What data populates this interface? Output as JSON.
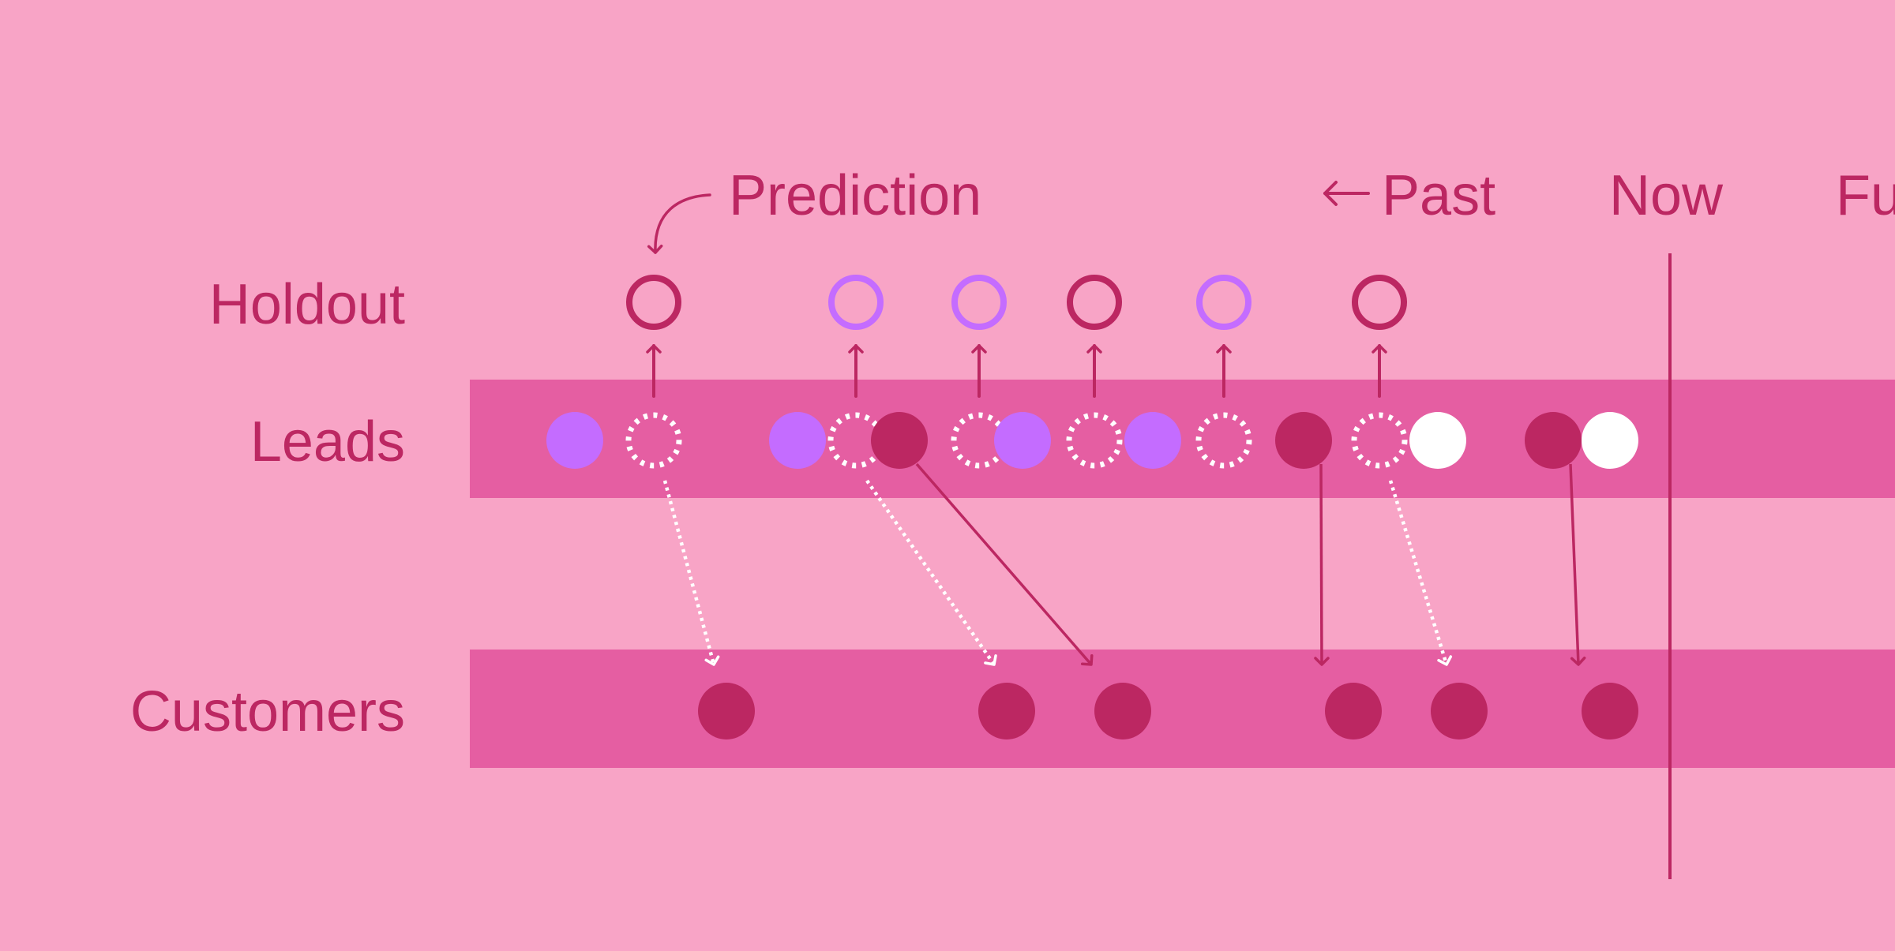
{
  "colors": {
    "background": "#F8A4C6",
    "band": "#E55EA2",
    "accent": "#BC2762",
    "purple": "#C46CFF",
    "white": "#FFFFFF"
  },
  "labels": {
    "prediction": "Prediction",
    "past": "Past",
    "past_arrow": "←",
    "now": "Now",
    "future": "Future"
  },
  "rows": {
    "holdout": "Holdout",
    "leads": "Leads",
    "customers": "Customers"
  },
  "legend_semantics": {
    "purple": "lead that did not convert",
    "dark": "lead that converted",
    "white": "lead not yet resolved",
    "dashed": "lead moved to holdout"
  },
  "holdout": [
    {
      "slot": 1,
      "color": "dark"
    },
    {
      "slot": 4,
      "color": "purple"
    },
    {
      "slot": 6,
      "color": "purple"
    },
    {
      "slot": 8,
      "color": "dark"
    },
    {
      "slot": 10,
      "color": "purple"
    },
    {
      "slot": 12,
      "color": "dark"
    }
  ],
  "leads": [
    {
      "id": "L1",
      "type": "purple"
    },
    {
      "id": "L2",
      "type": "dashed",
      "holdout": 0
    },
    {
      "id": "L3",
      "type": "purple"
    },
    {
      "id": "L4",
      "type": "dashed",
      "holdout": 1
    },
    {
      "id": "L5",
      "type": "dark"
    },
    {
      "id": "L6",
      "type": "dashed",
      "holdout": 2
    },
    {
      "id": "L7",
      "type": "purple"
    },
    {
      "id": "L8",
      "type": "dashed",
      "holdout": 3
    },
    {
      "id": "L9",
      "type": "purple"
    },
    {
      "id": "L10",
      "type": "dashed",
      "holdout": 4
    },
    {
      "id": "L11",
      "type": "dark"
    },
    {
      "id": "L12",
      "type": "dashed",
      "holdout": 5
    },
    {
      "id": "L13",
      "type": "white"
    },
    {
      "id": "L14",
      "type": "dark"
    },
    {
      "id": "L15",
      "type": "white"
    }
  ],
  "customers": [
    {
      "id": "C1",
      "from": "L2",
      "style": "dotted"
    },
    {
      "id": "C2",
      "from": "L4",
      "style": "dotted"
    },
    {
      "id": "C3",
      "from": "L5",
      "style": "solid"
    },
    {
      "id": "C4",
      "from": "L11",
      "style": "solid"
    },
    {
      "id": "C5",
      "from": "L12",
      "style": "dotted"
    },
    {
      "id": "C6",
      "from": "L14",
      "style": "solid"
    }
  ]
}
